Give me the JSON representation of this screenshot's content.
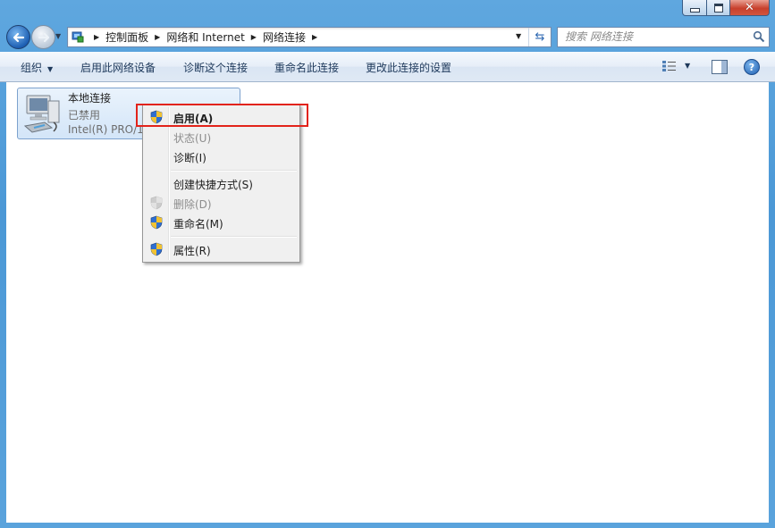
{
  "window": {
    "minimize_icon": "minimize-icon",
    "maximize_icon": "maximize-icon",
    "close_icon": "close-icon"
  },
  "nav": {
    "back_icon": "back-arrow-icon",
    "forward_icon": "forward-arrow-icon",
    "breadcrumbs": [
      "控制面板",
      "网络和 Internet",
      "网络连接"
    ],
    "search_placeholder": "搜索 网络连接"
  },
  "toolbar": {
    "organize": "组织",
    "enable_device": "启用此网络设备",
    "diagnose": "诊断这个连接",
    "rename": "重命名此连接",
    "change_settings": "更改此连接的设置",
    "help_glyph": "?"
  },
  "connection": {
    "name": "本地连接",
    "status": "已禁用",
    "device": "Intel(R) PRO/1000 MT Network Connection",
    "icon": "network-adapter-icon"
  },
  "context_menu": {
    "items": [
      {
        "label": "启用(A)",
        "shield": true,
        "disabled": false,
        "bold": true
      },
      {
        "label": "状态(U)",
        "shield": false,
        "disabled": true,
        "bold": false
      },
      {
        "label": "诊断(I)",
        "shield": false,
        "disabled": false,
        "bold": false
      },
      {
        "label": "创建快捷方式(S)",
        "shield": false,
        "disabled": false,
        "bold": false
      },
      {
        "label": "删除(D)",
        "shield": true,
        "disabled": true,
        "bold": false
      },
      {
        "label": "重命名(M)",
        "shield": true,
        "disabled": false,
        "bold": false
      },
      {
        "label": "属性(R)",
        "shield": true,
        "disabled": false,
        "bold": false
      }
    ]
  },
  "colors": {
    "highlight_box": "#e2231a",
    "selection_fill": "#d3e5f8",
    "toolbar_text": "#1e395b"
  }
}
